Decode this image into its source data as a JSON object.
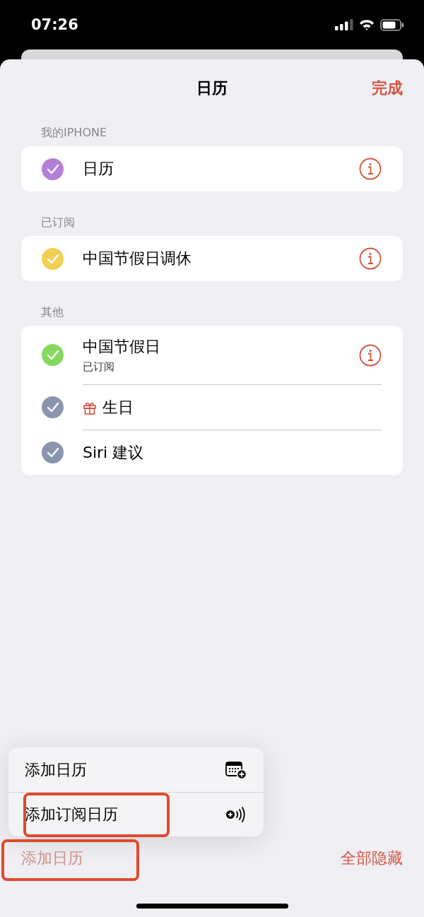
{
  "status_bar": {
    "time": "07:26"
  },
  "header": {
    "title": "日历",
    "done": "完成"
  },
  "sections": [
    {
      "title": "我的IPHONE",
      "calendars": [
        {
          "name": "日历",
          "kind": "info",
          "checked": true,
          "color": "#b47fd8"
        }
      ]
    },
    {
      "title": "已订阅",
      "calendars": [
        {
          "name": "中国节假日调休",
          "kind": "info",
          "checked": true,
          "color": "#f2cf55"
        }
      ]
    },
    {
      "title": "其他",
      "calendars": [
        {
          "name": "中国节假日",
          "subtitle": "已订阅",
          "kind": "info",
          "checked": true,
          "color": "#86d95c"
        },
        {
          "name": "生日",
          "kind": "birthday",
          "checked": true,
          "color": "#8a95ad"
        },
        {
          "name": "Siri 建议",
          "kind": "plain",
          "checked": true,
          "color": "#8a95ad"
        }
      ]
    }
  ],
  "menu": [
    {
      "label": "添加日历",
      "kind": "calendar",
      "highlighted": false
    },
    {
      "label": "添加订阅日历",
      "kind": "subscribe",
      "highlighted": true
    }
  ],
  "toolbar": {
    "add": {
      "label": "添加日历",
      "disabled": true,
      "highlighted": true
    },
    "hide_all": "全部隐藏"
  }
}
